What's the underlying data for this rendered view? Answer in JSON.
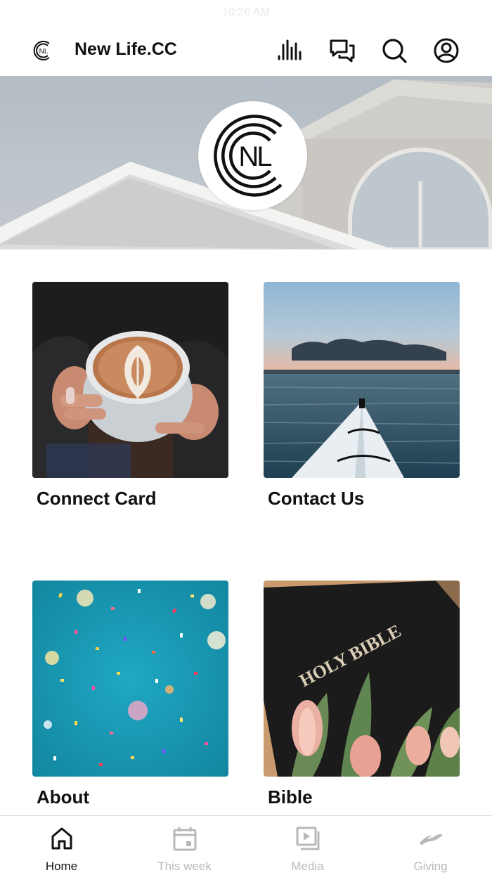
{
  "status_bar": {
    "time": "10:26 AM"
  },
  "header": {
    "title": "New Life.CC",
    "icons": [
      "equalizer-icon",
      "chat-icon",
      "search-icon",
      "profile-icon"
    ]
  },
  "hero": {
    "logo_text": "NL",
    "icon": "church-logo"
  },
  "tiles": [
    {
      "label": "Connect Card",
      "image": "coffee-latte-photo"
    },
    {
      "label": "Contact Us",
      "image": "kayak-lake-photo"
    },
    {
      "label": "About",
      "image": "confetti-photo"
    },
    {
      "label": "Bible",
      "image": "holy-bible-tulips-photo",
      "image_text": "HOLY BIBLE"
    }
  ],
  "tabs": [
    {
      "label": "Home",
      "icon": "home-icon",
      "active": true
    },
    {
      "label": "This week",
      "icon": "calendar-icon",
      "active": false
    },
    {
      "label": "Media",
      "icon": "media-icon",
      "active": false
    },
    {
      "label": "Giving",
      "icon": "giving-hand-icon",
      "active": false
    }
  ],
  "colors": {
    "active_tab": "#111111",
    "inactive_tab": "#b8b8b8",
    "header_border": "#e8e8e8"
  }
}
